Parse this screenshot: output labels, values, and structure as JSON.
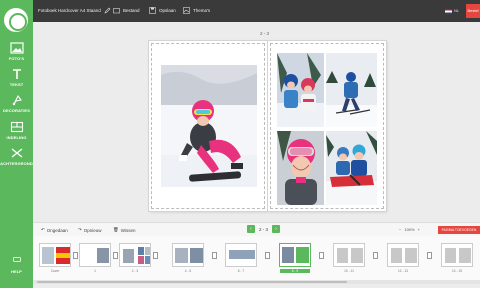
{
  "sidebar": {
    "items": [
      {
        "label": "FOTO'S",
        "icon": "photo-icon"
      },
      {
        "label": "TEKST",
        "icon": "text-icon"
      },
      {
        "label": "DECORATIES",
        "icon": "decoration-icon"
      },
      {
        "label": "INDELING",
        "icon": "layout-icon"
      },
      {
        "label": "ACHTERGROND",
        "icon": "background-icon"
      }
    ],
    "help_label": "HELP"
  },
  "topbar": {
    "title": "Fotoboek Hardcover A4 Staand",
    "menu": [
      "Bestand",
      "Opslaan",
      "Thema's"
    ],
    "language": "NL",
    "order_label": "Bestel"
  },
  "canvas": {
    "spread_label": "2 - 3"
  },
  "toolbar": {
    "undo": "Ongedaan",
    "redo": "Opnieuw",
    "delete": "Wissen",
    "page_indicator": "2 - 3",
    "zoom": "100%",
    "add_pages": "PAGINA TOEVOEGEN"
  },
  "thumbnails": [
    {
      "label": "Cover",
      "type": "cover"
    },
    {
      "label": "1",
      "type": "photo"
    },
    {
      "label": "2 - 3",
      "type": "photo"
    },
    {
      "label": "4 - 5",
      "type": "photo"
    },
    {
      "label": "6 - 7",
      "type": "photo"
    },
    {
      "label": "8 - 9",
      "type": "photo",
      "active": true
    },
    {
      "label": "10 - 11",
      "type": "empty"
    },
    {
      "label": "12 - 13",
      "type": "empty"
    },
    {
      "label": "14 - 15",
      "type": "empty"
    }
  ],
  "colors": {
    "accent": "#5cb85c",
    "order": "#e5463f",
    "topbar": "#3a3a3a"
  }
}
